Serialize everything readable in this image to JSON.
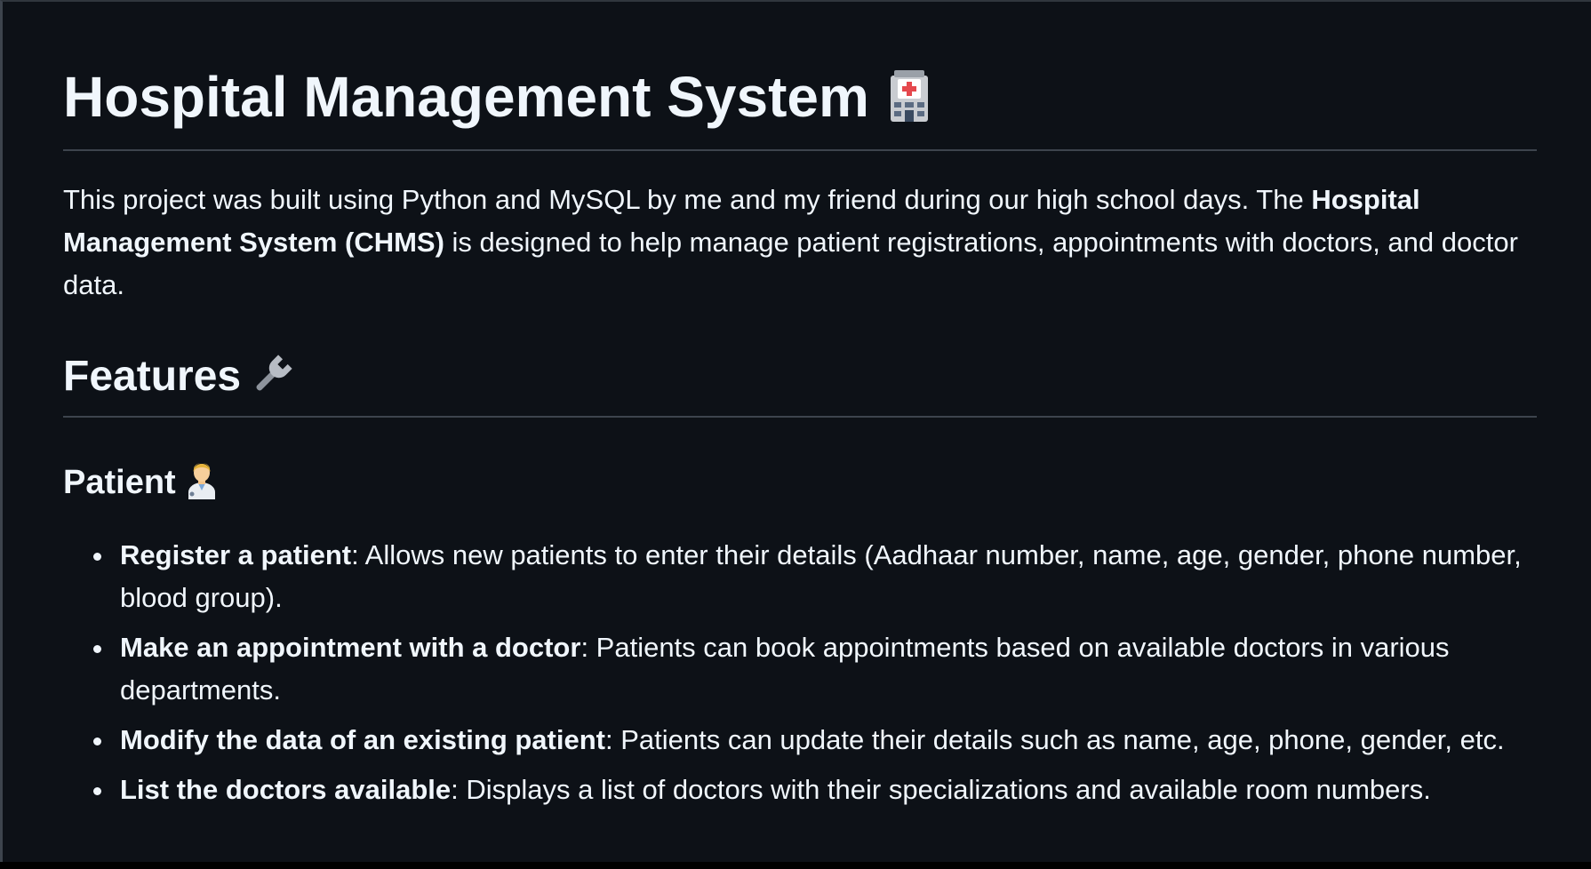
{
  "title": "Hospital Management System",
  "intro": {
    "text_before": "This project was built using Python and MySQL by me and my friend during our high school days. The ",
    "bold": "Hospital Management System (CHMS)",
    "text_after": " is designed to help manage patient registrations, appointments with doctors, and doctor data."
  },
  "features_heading": "Features",
  "patient_heading": "Patient",
  "icons": {
    "title": "hospital-icon",
    "features": "wrench-icon",
    "patient": "health-worker-icon"
  },
  "patient_features": [
    {
      "bold": "Register a patient",
      "text": ": Allows new patients to enter their details (Aadhaar number, name, age, gender, phone number, blood group)."
    },
    {
      "bold": "Make an appointment with a doctor",
      "text": ": Patients can book appointments based on available doctors in various departments."
    },
    {
      "bold": "Modify the data of an existing patient",
      "text": ": Patients can update their details such as name, age, phone, gender, etc."
    },
    {
      "bold": "List the doctors available",
      "text": ": Displays a list of doctors with their specializations and available room numbers."
    }
  ],
  "colors": {
    "background": "#0d1117",
    "text": "#f0f6fc",
    "divider": "#3d444d",
    "accent_red": "#e5484d"
  }
}
